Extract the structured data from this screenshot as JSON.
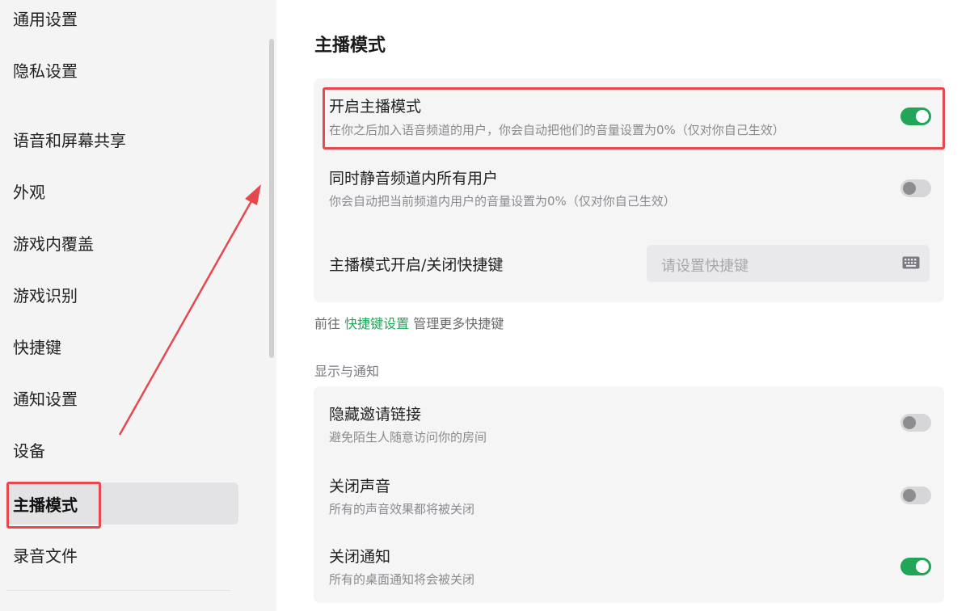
{
  "sidebar": {
    "items": [
      {
        "label": "通用设置"
      },
      {
        "label": "隐私设置"
      },
      {
        "label": "语音和屏幕共享"
      },
      {
        "label": "外观"
      },
      {
        "label": "游戏内覆盖"
      },
      {
        "label": "游戏识别"
      },
      {
        "label": "快捷键"
      },
      {
        "label": "通知设置"
      },
      {
        "label": "设备"
      },
      {
        "label": "主播模式"
      },
      {
        "label": "录音文件"
      }
    ],
    "active": "主播模式"
  },
  "main": {
    "title": "主播模式",
    "settings": [
      {
        "title": "开启主播模式",
        "desc": "在你之后加入语音频道的用户，你会自动把他们的音量设置为0%（仅对你自己生效）",
        "enabled": true
      },
      {
        "title": "同时静音频道内所有用户",
        "desc": "你会自动把当前频道内用户的音量设置为0%（仅对你自己生效）",
        "enabled": false
      }
    ],
    "hotkey": {
      "label": "主播模式开启/关闭快捷键",
      "placeholder": "请设置快捷键",
      "icon": "keyboard-icon"
    },
    "link_line": {
      "prefix": "前往",
      "link": "快捷键设置",
      "suffix": "管理更多快捷键"
    },
    "section_label": "显示与通知",
    "display_settings": [
      {
        "title": "隐藏邀请链接",
        "desc": "避免陌生人随意访问你的房间",
        "enabled": false
      },
      {
        "title": "关闭声音",
        "desc": "所有的声音效果都将被关闭",
        "enabled": false
      },
      {
        "title": "关闭通知",
        "desc": "所有的桌面通知将会被关闭",
        "enabled": true
      }
    ]
  },
  "colors": {
    "accent_green": "#23a559",
    "annotation_red": "#e5484d"
  }
}
